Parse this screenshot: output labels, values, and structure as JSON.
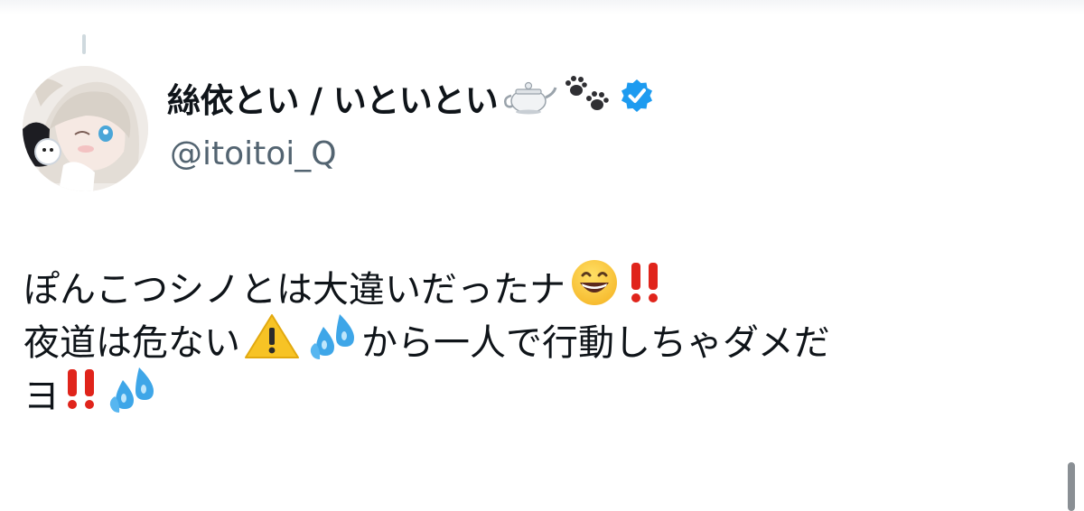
{
  "post": {
    "author": {
      "display_name": "絲依とい / いといとい",
      "name_emojis": [
        "teapot-emoji",
        "paw-prints-emoji"
      ],
      "verified": true,
      "handle": "@itoitoi_Q"
    },
    "text_segments": {
      "line1_text": "ぽんこつシノとは大違いだったナ",
      "line2_a": "夜道は危ない",
      "line2_b": "から一人で行動しちゃダメだ",
      "line3_text": "ヨ"
    },
    "emojis": [
      "grinning-face-emoji",
      "double-exclamation-emoji",
      "warning-emoji",
      "sweat-droplets-emoji"
    ]
  },
  "colors": {
    "text": "#0f1419",
    "handle": "#536471",
    "verified_badge": "#1d9bf0",
    "double_exclamation": "#e0241b",
    "warning": "#f7c325",
    "droplets": "#3ea6e8"
  }
}
